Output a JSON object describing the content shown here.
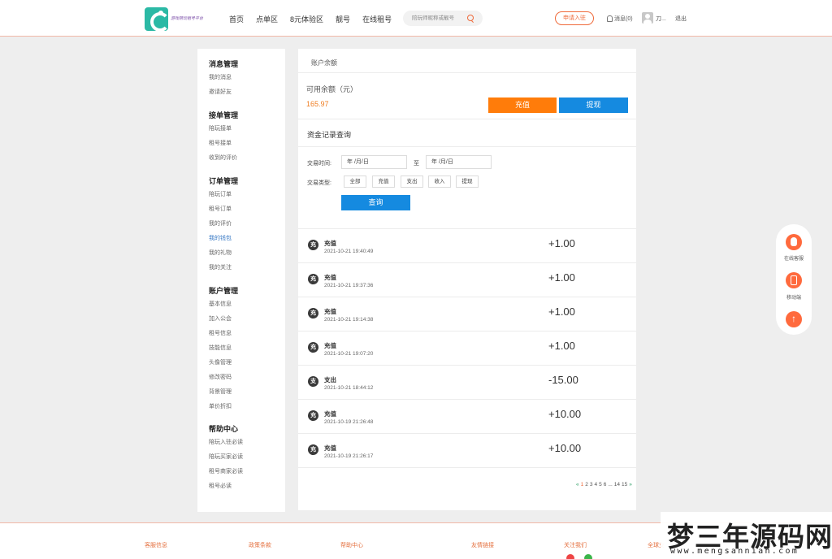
{
  "header": {
    "logo_text": "游戏陪玩租号平台",
    "nav": [
      "首页",
      "点单区",
      "8元体验区",
      "靓号",
      "在线租号"
    ],
    "search_placeholder": "陪玩师昵称或靓号",
    "apply_label": "申请入驻",
    "messages_label": "消息(0)",
    "username": "刀...",
    "logout_label": "退出"
  },
  "sidebar": {
    "groups": [
      {
        "title": "消息管理",
        "items": [
          "我的消息",
          "邀请好友"
        ]
      },
      {
        "title": "接单管理",
        "items": [
          "陪玩接单",
          "租号接单",
          "收到的评价"
        ]
      },
      {
        "title": "订单管理",
        "items": [
          "陪玩订单",
          "租号订单",
          "我的评价",
          "我的钱包",
          "我的礼物",
          "我的关注"
        ]
      },
      {
        "title": "账户管理",
        "items": [
          "基本信息",
          "加入公会",
          "租号信息",
          "技能信息",
          "头像管理",
          "修改密码",
          "背景管理",
          "单价折扣"
        ]
      },
      {
        "title": "帮助中心",
        "items": [
          "陪玩入驻必读",
          "陪玩买家必读",
          "租号商家必读",
          "租号必读"
        ]
      }
    ],
    "active_item": "我的钱包"
  },
  "main": {
    "header_title": "账户余额",
    "balance_label": "可用余额（元）",
    "balance_value": "165.97",
    "recharge_label": "充值",
    "withdraw_label": "提现",
    "records_title": "资金记录查询",
    "trade_time_label": "交易时间:",
    "date_from": "年 /月/日",
    "to_label": "至",
    "date_to": "年 /月/日",
    "trade_type_label": "交易类型:",
    "types": [
      "全部",
      "充值",
      "支出",
      "收入",
      "提现"
    ],
    "query_label": "查询",
    "records": [
      {
        "icon": "充",
        "type": "充值",
        "time": "2021-10-21 19:40:49",
        "amount": "+1.00"
      },
      {
        "icon": "充",
        "type": "充值",
        "time": "2021-10-21 19:37:36",
        "amount": "+1.00"
      },
      {
        "icon": "充",
        "type": "充值",
        "time": "2021-10-21 19:14:38",
        "amount": "+1.00"
      },
      {
        "icon": "充",
        "type": "充值",
        "time": "2021-10-21 19:07:20",
        "amount": "+1.00"
      },
      {
        "icon": "支",
        "type": "支出",
        "time": "2021-10-21 18:44:12",
        "amount": "-15.00"
      },
      {
        "icon": "充",
        "type": "充值",
        "time": "2021-10-19 21:26:48",
        "amount": "+10.00"
      },
      {
        "icon": "充",
        "type": "充值",
        "time": "2021-10-19 21:26:17",
        "amount": "+10.00"
      }
    ],
    "pager": {
      "prev": "«",
      "pages": [
        "1",
        "2",
        "3",
        "4",
        "5",
        "6",
        "...",
        "14",
        "15"
      ],
      "current": "1",
      "next": "»"
    }
  },
  "float_panel": {
    "service_label": "在线客服",
    "mobile_label": "移动端"
  },
  "footer": {
    "columns": [
      "客服信息",
      "政策条款",
      "帮助中心",
      "友情链接",
      "关注我们",
      "全球支"
    ]
  },
  "watermark": {
    "cn": "梦三年源码网",
    "en": "www.mengsannian.com"
  },
  "colors": {
    "accent_orange": "#ff7c0a",
    "accent_blue": "#158ae0",
    "brand_red": "#ef6a3a",
    "link_blue": "#3778c4"
  }
}
